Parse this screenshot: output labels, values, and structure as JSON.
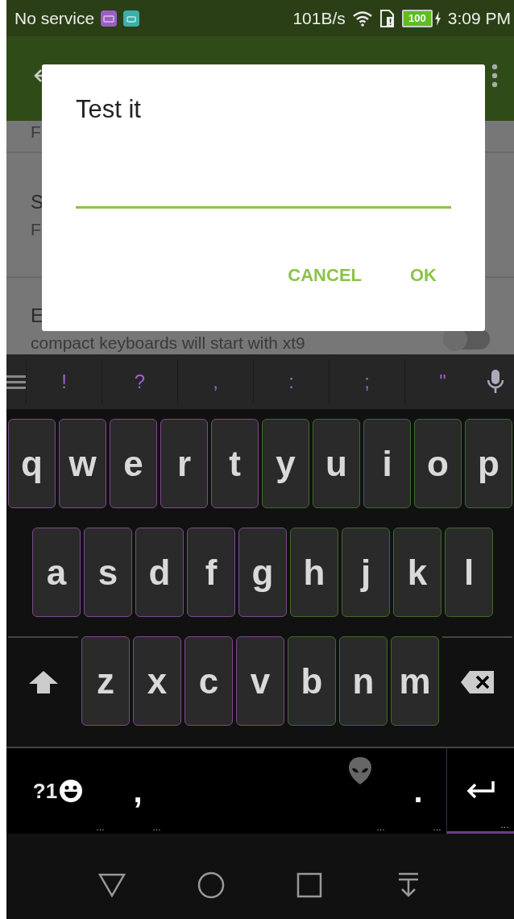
{
  "status_bar": {
    "carrier": "No service",
    "speed": "101B/s",
    "battery": "100",
    "time": "3:09 PM"
  },
  "settings_list": [
    {
      "subtitle": "F"
    },
    {
      "title": "S",
      "subtitle": "F"
    },
    {
      "title": "E",
      "subtitle": "compact keyboards will start with xt9",
      "toggle": {
        "on": false
      }
    }
  ],
  "dialog": {
    "title": "Test it",
    "buttons": [
      "CANCEL",
      "OK"
    ]
  },
  "keyboard": {
    "suggestions": [
      "!",
      "?",
      ",",
      ":",
      ";",
      "\""
    ],
    "rows": [
      {
        "keys": [
          {
            "kind": "letter",
            "label": "q",
            "color": "#7b4a8c"
          },
          {
            "kind": "letter",
            "label": "w",
            "color": "#7b4a8c"
          },
          {
            "kind": "letter",
            "label": "e",
            "color": "#7b4a8c"
          },
          {
            "kind": "letter",
            "label": "r",
            "color": "#7b4a8c"
          },
          {
            "kind": "letter",
            "label": "t",
            "color": "#7b4a8c"
          },
          {
            "kind": "letter",
            "label": "y",
            "color": "#3f6a2a"
          },
          {
            "kind": "letter",
            "label": "u",
            "color": "#3f6a2a"
          },
          {
            "kind": "letter",
            "label": "i",
            "color": "#3f6a2a"
          },
          {
            "kind": "letter",
            "label": "o",
            "color": "#3f6a2a"
          },
          {
            "kind": "letter",
            "label": "p",
            "color": "#3f6a2a"
          }
        ]
      },
      {
        "keys": [
          {
            "kind": "letter",
            "label": "a",
            "color": "#7b4a8c"
          },
          {
            "kind": "letter",
            "label": "s",
            "color": "#7b4a8c"
          },
          {
            "kind": "letter",
            "label": "d",
            "color": "#7b4a8c"
          },
          {
            "kind": "letter",
            "label": "f",
            "color": "#7b4a8c"
          },
          {
            "kind": "letter",
            "label": "g",
            "color": "#7b4a8c"
          },
          {
            "kind": "letter",
            "label": "h",
            "color": "#3f6a2a"
          },
          {
            "kind": "letter",
            "label": "j",
            "color": "#3f6a2a"
          },
          {
            "kind": "letter",
            "label": "k",
            "color": "#3f6a2a"
          },
          {
            "kind": "letter",
            "label": "l",
            "color": "#3f6a2a"
          }
        ]
      },
      {
        "keys": [
          {
            "kind": "shift"
          },
          {
            "kind": "letter",
            "label": "z",
            "color": "#7b4a8c"
          },
          {
            "kind": "letter",
            "label": "x",
            "color": "#7b4a8c"
          },
          {
            "kind": "letter",
            "label": "c",
            "color": "#7b4a8c"
          },
          {
            "kind": "letter",
            "label": "v",
            "color": "#7b4a8c"
          },
          {
            "kind": "letter",
            "label": "b",
            "color": "#3f6a2a"
          },
          {
            "kind": "letter",
            "label": "n",
            "color": "#3f6a2a"
          },
          {
            "kind": "letter",
            "label": "m",
            "color": "#3f6a2a"
          },
          {
            "kind": "backspace"
          }
        ]
      },
      {
        "keys": [
          {
            "kind": "symbols",
            "label": "?1",
            "hint": "…"
          },
          {
            "kind": "char",
            "label": ",",
            "hint": "…"
          },
          {
            "kind": "space",
            "hint": "…"
          },
          {
            "kind": "char",
            "label": ".",
            "hint": "…"
          },
          {
            "kind": "enter",
            "hint": "…"
          }
        ]
      }
    ]
  },
  "nav_bar": [
    {
      "kind": "back"
    },
    {
      "kind": "home"
    },
    {
      "kind": "recents"
    },
    {
      "kind": "hide-keyboard"
    }
  ]
}
